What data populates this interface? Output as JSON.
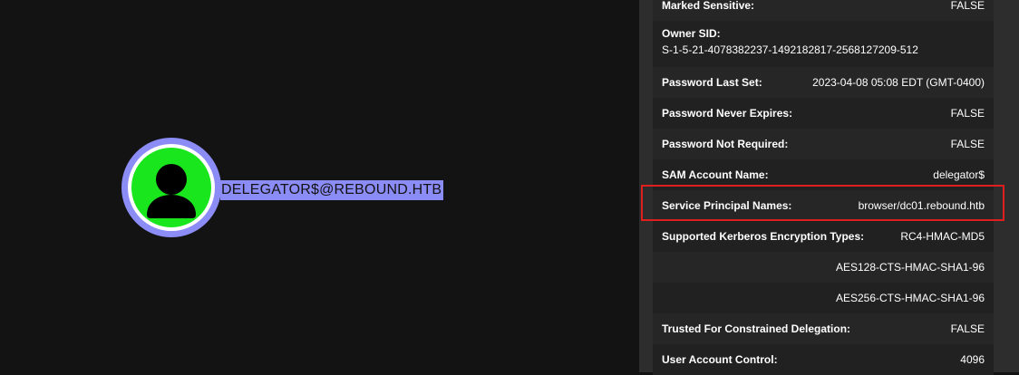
{
  "graph": {
    "node": {
      "label": "DELEGATOR$@REBOUND.HTB",
      "icon": "user-icon",
      "colors": {
        "ring": "#8c8cf7",
        "fill": "#19e61d",
        "label_bg": "#8c8cf7"
      }
    }
  },
  "panel": {
    "rows": [
      {
        "key": "Marked Sensitive:",
        "value": "FALSE"
      },
      {
        "key": "Owner SID:",
        "value": "S-1-5-21-4078382237-1492182817-2568127209-512"
      },
      {
        "key": "Password Last Set:",
        "value": "2023-04-08 05:08 EDT (GMT-0400)"
      },
      {
        "key": "Password Never Expires:",
        "value": "FALSE"
      },
      {
        "key": "Password Not Required:",
        "value": "FALSE"
      },
      {
        "key": "SAM Account Name:",
        "value": "delegator$"
      },
      {
        "key": "Service Principal Names:",
        "value": "browser/dc01.rebound.htb"
      },
      {
        "key": "Supported Kerberos Encryption Types:",
        "value": "RC4-HMAC-MD5"
      },
      {
        "key": "",
        "value": "AES128-CTS-HMAC-SHA1-96"
      },
      {
        "key": "",
        "value": "AES256-CTS-HMAC-SHA1-96"
      },
      {
        "key": "Trusted For Constrained Delegation:",
        "value": "FALSE"
      },
      {
        "key": "User Account Control:",
        "value": "4096"
      }
    ],
    "highlight_color": "#e01e1e"
  }
}
